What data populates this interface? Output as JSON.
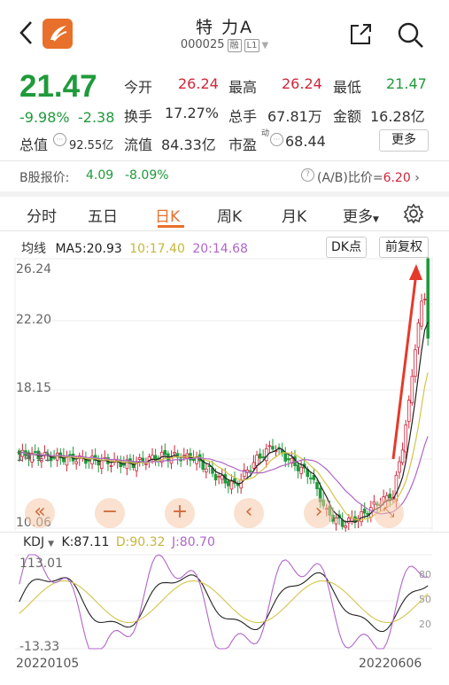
{
  "header": {
    "stock_name": "特 力A",
    "stock_code": "000025",
    "tag_margin": "融",
    "tag_level": "L1"
  },
  "quote": {
    "price": "21.47",
    "change_pct": "-9.98%",
    "change_amt": "-2.38",
    "open_label": "今开",
    "open": "26.24",
    "high_label": "最高",
    "high": "26.24",
    "low_label": "最低",
    "low": "21.47",
    "turnover_label": "换手",
    "turnover": "17.27%",
    "volume_label": "总手",
    "volume": "67.81万",
    "amount_label": "金额",
    "amount": "16.28亿",
    "mktcap_label": "总值",
    "mktcap": "92.55亿",
    "float_label": "流值",
    "float": "84.33亿",
    "pe_label": "市盈",
    "pe_sup": "动",
    "pe": "68.44",
    "more_label": "更多"
  },
  "b_share": {
    "label": "B股报价:",
    "price": "4.09",
    "change": "-8.09%",
    "ratio_label": "(A/B)比价=",
    "ratio": "6.20"
  },
  "tabs": [
    "分时",
    "五日",
    "日K",
    "周K",
    "月K",
    "更多"
  ],
  "active_tab": "日K",
  "ma_bar": {
    "label": "均线",
    "ma5": "MA5:20.93",
    "ma10": "10:17.40",
    "ma20": "20:14.68",
    "dk_button": "DK点",
    "adjust_button": "前复权"
  },
  "price_axis": [
    "26.24",
    "22.20",
    "18.15",
    "14.11",
    "10.06"
  ],
  "kdj_bar": {
    "label": "KDJ",
    "k": "K:87.11",
    "d": "D:90.32",
    "j": "J:80.70"
  },
  "kdj_axis": {
    "top": "113.01",
    "bottom": "-13.33",
    "r80": "80",
    "r50": "50",
    "r20": "20"
  },
  "date_range": {
    "start": "20220105",
    "end": "20220606"
  },
  "colors": {
    "up": "#d0253a",
    "down": "#1f9a3a",
    "ma5": "#222222",
    "ma10": "#d4c44a",
    "ma20": "#b066c8",
    "accent": "#e8702a"
  },
  "chart_data": {
    "type": "candlestick",
    "y_range": [
      10.06,
      26.24
    ],
    "kdj_range": [
      -13.33,
      113.01
    ],
    "last_close": 21.47,
    "last_open": 26.24,
    "last_high": 26.24,
    "last_low": 21.47
  }
}
